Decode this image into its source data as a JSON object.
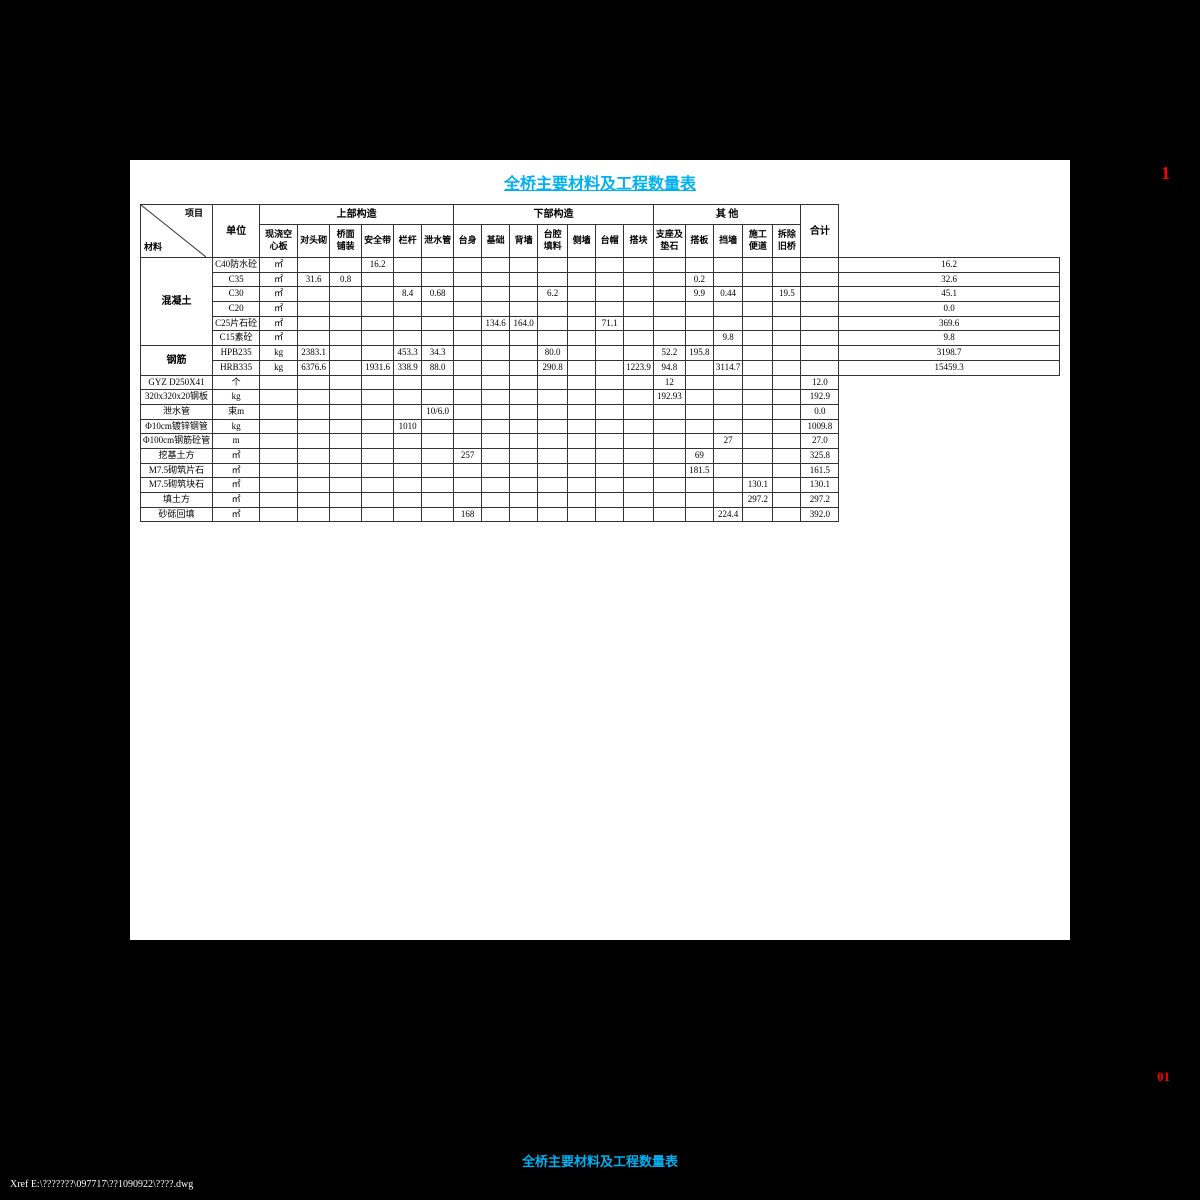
{
  "title": "全桥主要材料及工程数量表",
  "bottom_label": "全桥主要材料及工程数量表",
  "bottom_num": "01",
  "xref": "Xref E:\\???????\\097717\\??1090922\\????.dwg",
  "page_number": "1",
  "header": {
    "diagonal_top": "项目",
    "diagonal_bottom": "材料",
    "unit_label": "单位",
    "upper_group": "上部构造",
    "lower_group": "下部构造",
    "other_group": "其 他",
    "total_label": "合计",
    "upper_cols": [
      "现浇空心板",
      "对头砌",
      "桥面铺装",
      "安全带",
      "栏杆",
      "泄水管"
    ],
    "lower_cols": [
      "台身",
      "基础",
      "背墙",
      "台腔填料",
      "侧墙",
      "台帽",
      "搭块"
    ],
    "other_cols": [
      "支座及垫石",
      "搭板",
      "挡墙",
      "施工便道",
      "拆除旧桥"
    ]
  },
  "rows": [
    {
      "material": "混凝土",
      "sub_rows": [
        {
          "name": "C40防水砼",
          "unit": "㎡",
          "upper": [
            "",
            "",
            "16.2",
            "",
            "",
            ""
          ],
          "lower": [
            "",
            "",
            "",
            "",
            "",
            "",
            ""
          ],
          "other": [
            "",
            "",
            "",
            "",
            ""
          ],
          "total": "16.2"
        },
        {
          "name": "C35",
          "unit": "㎡",
          "upper": [
            "31.6",
            "0.8",
            "",
            "",
            "",
            ""
          ],
          "lower": [
            "",
            "",
            "",
            "",
            "",
            "",
            ""
          ],
          "other": [
            "0.2",
            "",
            "",
            "",
            ""
          ],
          "total": "32.6"
        },
        {
          "name": "C30",
          "unit": "㎡",
          "upper": [
            "",
            "",
            "",
            "8.4",
            "0.68",
            ""
          ],
          "lower": [
            "",
            "",
            "6.2",
            "",
            "",
            "",
            ""
          ],
          "other": [
            "9.9",
            "0.44",
            "",
            "19.5",
            ""
          ],
          "total": "45.1"
        },
        {
          "name": "C20",
          "unit": "㎡",
          "upper": [
            "",
            "",
            "",
            "",
            "",
            ""
          ],
          "lower": [
            "",
            "",
            "",
            "",
            "",
            "",
            ""
          ],
          "other": [
            "",
            "",
            "",
            "",
            ""
          ],
          "total": "0.0"
        },
        {
          "name": "C25片石砼",
          "unit": "㎡",
          "upper": [
            "",
            "",
            "",
            "",
            "",
            ""
          ],
          "lower": [
            "134.6",
            "164.0",
            "",
            "",
            "71.1",
            "",
            ""
          ],
          "other": [
            "",
            "",
            "",
            "",
            ""
          ],
          "total": "369.6"
        },
        {
          "name": "C15素砼",
          "unit": "㎡",
          "upper": [
            "",
            "",
            "",
            "",
            "",
            ""
          ],
          "lower": [
            "",
            "",
            "",
            "",
            "",
            "",
            ""
          ],
          "other": [
            "",
            "9.8",
            "",
            "",
            ""
          ],
          "total": "9.8"
        }
      ]
    },
    {
      "material": "钢筋",
      "sub_rows": [
        {
          "name": "HPB235",
          "unit": "kg",
          "upper": [
            "2383.1",
            "",
            "",
            "453.3",
            "34.3",
            ""
          ],
          "lower": [
            "",
            "",
            "80.0",
            "",
            "",
            "",
            "52.2"
          ],
          "other": [
            "195.8",
            "",
            "",
            "",
            ""
          ],
          "total": "3198.7"
        },
        {
          "name": "HRB335",
          "unit": "kg",
          "upper": [
            "6376.6",
            "",
            "1931.6",
            "338.9",
            "88.0",
            ""
          ],
          "lower": [
            "",
            "",
            "290.8",
            "",
            "",
            "1223.9",
            "94.8"
          ],
          "other": [
            "",
            "3114.7",
            "",
            "",
            ""
          ],
          "total": "15459.3"
        }
      ]
    },
    {
      "material": "",
      "sub_rows": [
        {
          "name": "GYZ D250X41",
          "unit": "个",
          "upper": [
            "",
            "",
            "",
            "",
            "",
            ""
          ],
          "lower": [
            "",
            "",
            "",
            "",
            "",
            "",
            ""
          ],
          "other": [
            "12",
            "",
            "",
            "",
            ""
          ],
          "total": "12.0"
        },
        {
          "name": "320x320x20钢板",
          "unit": "kg",
          "upper": [
            "",
            "",
            "",
            "",
            "",
            ""
          ],
          "lower": [
            "",
            "",
            "",
            "",
            "",
            "",
            ""
          ],
          "other": [
            "192.93",
            "",
            "",
            "",
            ""
          ],
          "total": "192.9"
        },
        {
          "name": "泄水管",
          "unit": "束m",
          "upper": [
            "",
            "",
            "",
            "",
            "",
            "10/6.0"
          ],
          "lower": [
            "",
            "",
            "",
            "",
            "",
            "",
            ""
          ],
          "other": [
            "",
            "",
            "",
            "",
            ""
          ],
          "total": "0.0"
        },
        {
          "name": "Φ10cm镀锌钢管",
          "unit": "kg",
          "upper": [
            "",
            "",
            "",
            "",
            "1010",
            ""
          ],
          "lower": [
            "",
            "",
            "",
            "",
            "",
            "",
            ""
          ],
          "other": [
            "",
            "",
            "",
            "",
            ""
          ],
          "total": "1009.8"
        },
        {
          "name": "Φ100cm钢筋砼管",
          "unit": "m",
          "upper": [
            "",
            "",
            "",
            "",
            "",
            ""
          ],
          "lower": [
            "",
            "",
            "",
            "",
            "",
            "",
            ""
          ],
          "other": [
            "",
            "",
            "27",
            "",
            ""
          ],
          "total": "27.0"
        },
        {
          "name": "挖基土方",
          "unit": "㎡",
          "upper": [
            "",
            "",
            "",
            "",
            "",
            ""
          ],
          "lower": [
            "257",
            "",
            "",
            "",
            "",
            "",
            ""
          ],
          "other": [
            "",
            "69",
            "",
            "",
            ""
          ],
          "total": "325.8"
        },
        {
          "name": "M7.5砌筑片石",
          "unit": "㎡",
          "upper": [
            "",
            "",
            "",
            "",
            "",
            ""
          ],
          "lower": [
            "",
            "",
            "",
            "",
            "",
            "",
            ""
          ],
          "other": [
            "",
            "181.5",
            "",
            "",
            ""
          ],
          "total": "161.5"
        },
        {
          "name": "M7.5砌筑块石",
          "unit": "㎡",
          "upper": [
            "",
            "",
            "",
            "",
            "",
            ""
          ],
          "lower": [
            "",
            "",
            "",
            "",
            "",
            "",
            ""
          ],
          "other": [
            "",
            "",
            "",
            "130.1",
            ""
          ],
          "total": "130.1"
        },
        {
          "name": "填土方",
          "unit": "㎡",
          "upper": [
            "",
            "",
            "",
            "",
            "",
            ""
          ],
          "lower": [
            "",
            "",
            "",
            "",
            "",
            "",
            ""
          ],
          "other": [
            "",
            "",
            "",
            "297.2",
            ""
          ],
          "total": "297.2"
        },
        {
          "name": "砂砾回填",
          "unit": "㎡",
          "upper": [
            "",
            "",
            "",
            "",
            "",
            ""
          ],
          "lower": [
            "168",
            "",
            "",
            "",
            "",
            "",
            ""
          ],
          "other": [
            "",
            "",
            "224.4",
            "",
            ""
          ],
          "total": "392.0"
        }
      ]
    }
  ]
}
